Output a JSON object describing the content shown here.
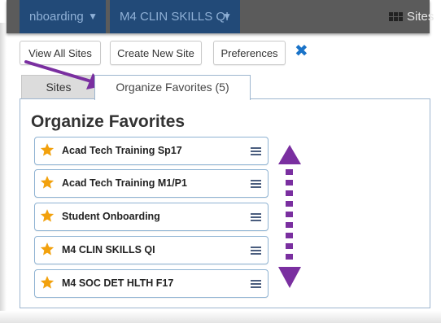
{
  "topbar": {
    "site_tabs": [
      {
        "label": "nboarding"
      },
      {
        "label": "M4 CLIN SKILLS QI"
      }
    ],
    "sites_menu_label": "Sites",
    "sites_icon": "grid-icon"
  },
  "toolbar": {
    "view_all_label": "View All Sites",
    "create_new_label": "Create New Site",
    "preferences_label": "Preferences",
    "close_icon": "close-icon"
  },
  "tabs": {
    "sites_label": "Sites",
    "organize_label": "Organize Favorites (5)"
  },
  "panel": {
    "title": "Organize Favorites",
    "favorites": [
      {
        "label": "Acad Tech Training Sp17"
      },
      {
        "label": "Acad Tech Training M1/P1"
      },
      {
        "label": "Student Onboarding"
      },
      {
        "label": "M4 CLIN SKILLS QI"
      },
      {
        "label": "M4 SOC DET HLTH F17"
      }
    ]
  },
  "colors": {
    "star": "#f2a10d",
    "annotation_arrow": "#7a2fa0",
    "site_tab_bg": "#224a78",
    "close_x": "#1a73c8"
  }
}
